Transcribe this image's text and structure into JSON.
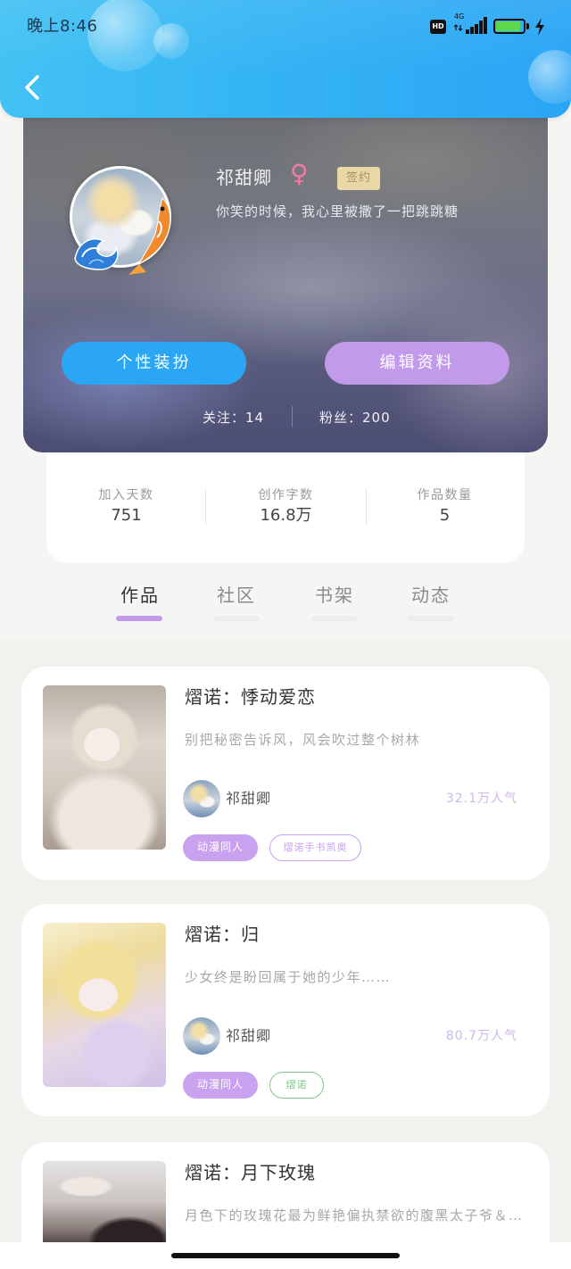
{
  "status_bar": {
    "time": "晚上8:46",
    "hd_label": "HD",
    "network_label": "4G",
    "battery_level": 0.9,
    "icons": [
      "hd-icon",
      "signal-icon",
      "battery-icon",
      "charging-bolt-icon"
    ]
  },
  "header": {
    "back_icon": "chevron-left-icon"
  },
  "profile": {
    "name": "祁甜卿",
    "gender_symbol": "♀",
    "badge": "签约",
    "bio": "你笑的时候，我心里被撒了一把跳跳糖",
    "decorate_button": "个性装扮",
    "edit_button": "编辑资料",
    "following": "关注：14",
    "fans": "粉丝：200"
  },
  "stats": [
    {
      "label": "加入天数",
      "value": "751"
    },
    {
      "label": "创作字数",
      "value": "16.8万"
    },
    {
      "label": "作品数量",
      "value": "5"
    }
  ],
  "tabs": {
    "items": [
      "作品",
      "社区",
      "书架",
      "动态"
    ],
    "active_index": 0
  },
  "works": [
    {
      "title": "熠诺：悸动爱恋",
      "description": "别把秘密告诉风，风会吹过整个树林",
      "author": "祁甜卿",
      "popularity": "32.1万人气",
      "tags": [
        "动漫同人",
        "熠诺手书凯奥"
      ]
    },
    {
      "title": "熠诺：归",
      "description": "少女终是盼回属于她的少年……",
      "author": "祁甜卿",
      "popularity": "80.7万人气",
      "tags": [
        "动漫同人",
        "熠诺"
      ]
    },
    {
      "title": "熠诺：月下玫瑰",
      "description": "月色下的玫瑰花最为鲜艳偏执禁欲的腹黑太子爷＆…"
    }
  ],
  "theme": {
    "header-a": "#42c2f3",
    "header-b": "#2aa5f5",
    "btn-blue": "#2ba6f4",
    "btn-purple": "#c19be9",
    "tag-purple": "#c9a2ef",
    "tag-green": "#80c98a",
    "pop": "#cdb8ec",
    "pink": "#f27aa6"
  }
}
